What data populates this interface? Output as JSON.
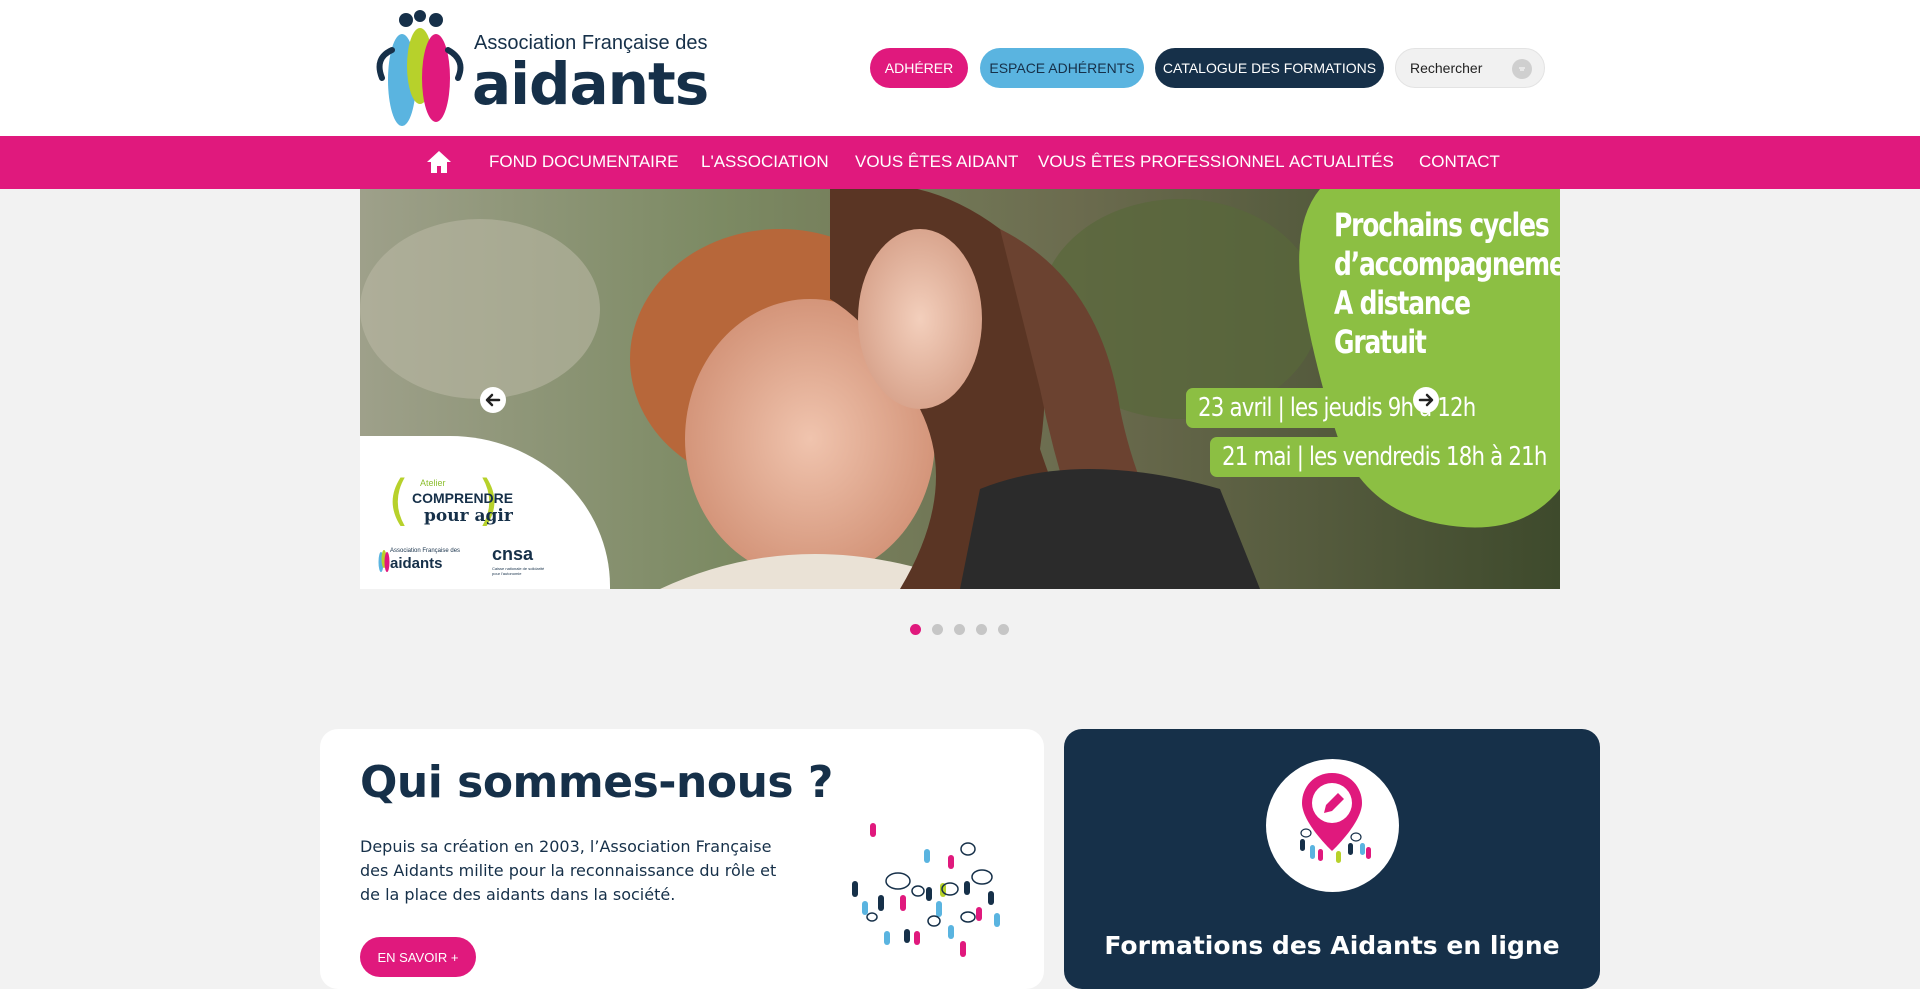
{
  "header": {
    "logo": {
      "line1": "Association Française des",
      "line2": "aidants",
      "icon": "three-people-logo-icon"
    },
    "buttons": {
      "join": "ADHÉRER",
      "members_area": "ESPACE ADHÉRENTS",
      "catalog": "CATALOGUE DES FORMATIONS"
    },
    "search": {
      "placeholder": "Rechercher",
      "icon": "search-icon"
    }
  },
  "nav": {
    "home_icon": "home-icon",
    "items": [
      {
        "label": "FOND DOCUMENTAIRE"
      },
      {
        "label": "L'ASSOCIATION"
      },
      {
        "label": "VOUS ÊTES AIDANT"
      },
      {
        "label": "VOUS ÊTES PROFESSIONNEL"
      },
      {
        "label": "ACTUALITÉS"
      },
      {
        "label": "CONTACT"
      }
    ]
  },
  "slider": {
    "prev_icon": "arrow-left-icon",
    "next_icon": "arrow-right-icon",
    "slide": {
      "promo_lines": [
        "Prochains cycles",
        "d’accompagnement",
        "A distance",
        "Gratuit"
      ],
      "session1": "23 avril | les jeudis 9h à 12h",
      "session2": "21 mai | les vendredis 18h à 21h",
      "badge": {
        "atelier": "Atelier",
        "line1": "COMPRENDRE",
        "line2": "pour agir",
        "mini_logo_line1": "Association Française des",
        "mini_logo_line2": "aidants",
        "partner": "cnsa",
        "partner_sub": "Caisse nationale de solidarité pour l'autonomie"
      }
    },
    "dots": {
      "count": 5,
      "active": 0
    },
    "colors": {
      "promo_green": "#8cbf43",
      "accent_pink": "#e0197d"
    }
  },
  "about": {
    "title": "Qui sommes-nous ?",
    "text": "Depuis sa création en 2003, l’Association Française des Aidants milite pour la reconnaissance du rôle et de la place des aidants dans la société.",
    "button": "EN SAVOIR +",
    "illustration": "crowd-speech-bubbles-illustration"
  },
  "formations": {
    "icon": "map-pin-pencil-icon",
    "title": "Formations des Aidants en ligne"
  },
  "colors": {
    "pink": "#e0197d",
    "navy": "#163049",
    "light_blue": "#5ab4e0",
    "green": "#8cbf43"
  }
}
